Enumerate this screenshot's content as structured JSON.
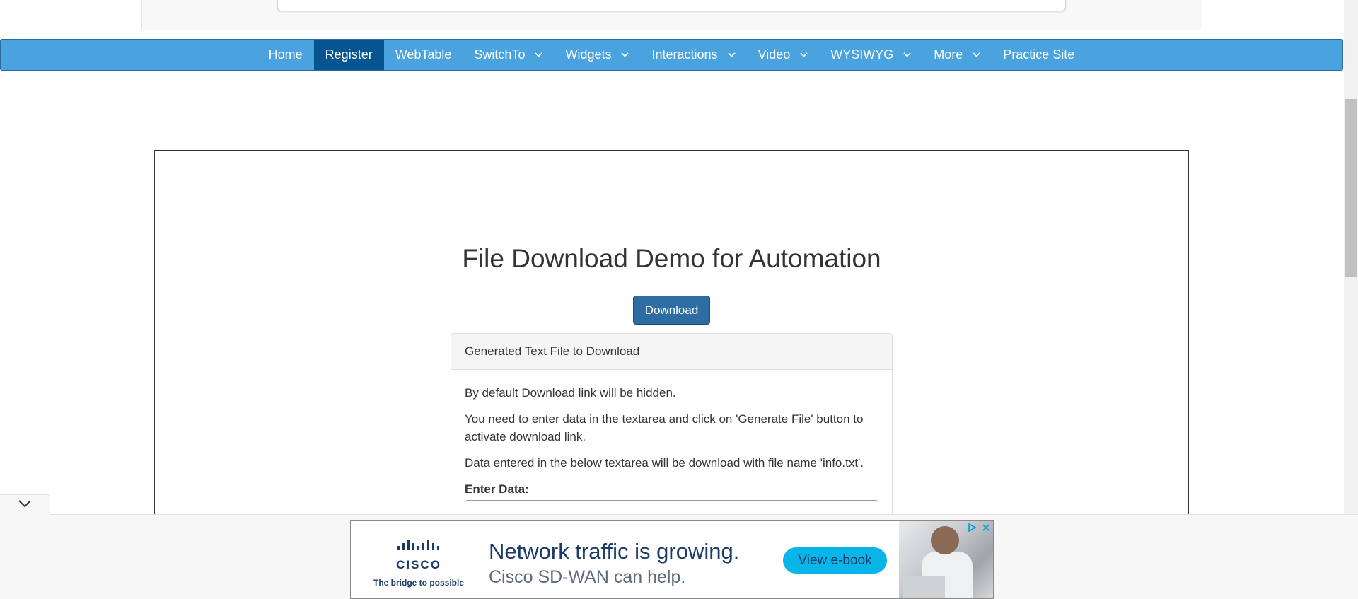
{
  "nav": {
    "items": [
      {
        "label": "Home",
        "active": false,
        "dropdown": false
      },
      {
        "label": "Register",
        "active": true,
        "dropdown": false
      },
      {
        "label": "WebTable",
        "active": false,
        "dropdown": false
      },
      {
        "label": "SwitchTo",
        "active": false,
        "dropdown": true
      },
      {
        "label": "Widgets",
        "active": false,
        "dropdown": true
      },
      {
        "label": "Interactions",
        "active": false,
        "dropdown": true
      },
      {
        "label": "Video",
        "active": false,
        "dropdown": true
      },
      {
        "label": "WYSIWYG",
        "active": false,
        "dropdown": true
      },
      {
        "label": "More",
        "active": false,
        "dropdown": true
      },
      {
        "label": "Practice Site",
        "active": false,
        "dropdown": false
      }
    ],
    "colors": {
      "bar": "#4aa3df",
      "active": "#075590"
    }
  },
  "main": {
    "title": "File Download Demo for Automation",
    "download_button": "Download",
    "panel": {
      "heading": "Generated Text File to Download",
      "p1": "By default Download link will be hidden.",
      "p2": "You need to enter data in the textarea and click on 'Generate File' button to activate download link.",
      "p3": "Data entered in the below textarea will be download with file name 'info.txt'.",
      "textarea_label": "Enter Data:",
      "textarea_value": ""
    }
  },
  "ad": {
    "brand": "CISCO",
    "tagline": "The bridge to possible",
    "headline": "Network traffic is growing.",
    "subline": "Cisco SD-WAN can help.",
    "cta": "View e-book",
    "colors": {
      "cta": "#08b5e8",
      "text": "#1b3c68"
    }
  },
  "icons": {
    "nav_dropdown": "chevron-down-icon",
    "collapse": "chevron-down-icon",
    "ad_choices": "ad-choices-icon",
    "ad_close": "close-icon"
  }
}
